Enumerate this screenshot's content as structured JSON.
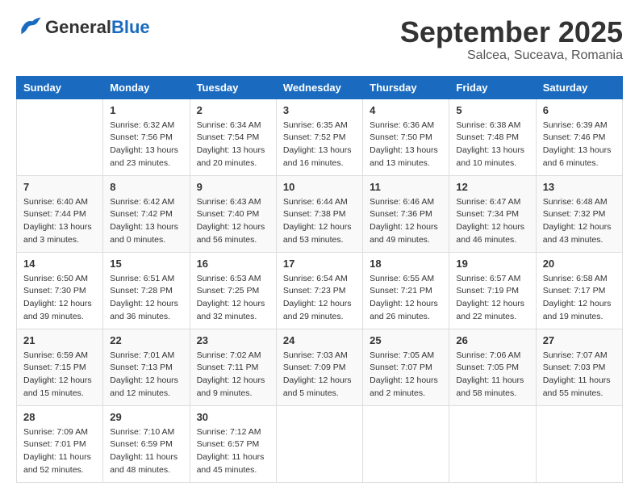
{
  "header": {
    "logo_general": "General",
    "logo_blue": "Blue",
    "month": "September 2025",
    "location": "Salcea, Suceava, Romania"
  },
  "weekdays": [
    "Sunday",
    "Monday",
    "Tuesday",
    "Wednesday",
    "Thursday",
    "Friday",
    "Saturday"
  ],
  "weeks": [
    [
      {
        "day": "",
        "sunrise": "",
        "sunset": "",
        "daylight": ""
      },
      {
        "day": "1",
        "sunrise": "Sunrise: 6:32 AM",
        "sunset": "Sunset: 7:56 PM",
        "daylight": "Daylight: 13 hours and 23 minutes."
      },
      {
        "day": "2",
        "sunrise": "Sunrise: 6:34 AM",
        "sunset": "Sunset: 7:54 PM",
        "daylight": "Daylight: 13 hours and 20 minutes."
      },
      {
        "day": "3",
        "sunrise": "Sunrise: 6:35 AM",
        "sunset": "Sunset: 7:52 PM",
        "daylight": "Daylight: 13 hours and 16 minutes."
      },
      {
        "day": "4",
        "sunrise": "Sunrise: 6:36 AM",
        "sunset": "Sunset: 7:50 PM",
        "daylight": "Daylight: 13 hours and 13 minutes."
      },
      {
        "day": "5",
        "sunrise": "Sunrise: 6:38 AM",
        "sunset": "Sunset: 7:48 PM",
        "daylight": "Daylight: 13 hours and 10 minutes."
      },
      {
        "day": "6",
        "sunrise": "Sunrise: 6:39 AM",
        "sunset": "Sunset: 7:46 PM",
        "daylight": "Daylight: 13 hours and 6 minutes."
      }
    ],
    [
      {
        "day": "7",
        "sunrise": "Sunrise: 6:40 AM",
        "sunset": "Sunset: 7:44 PM",
        "daylight": "Daylight: 13 hours and 3 minutes."
      },
      {
        "day": "8",
        "sunrise": "Sunrise: 6:42 AM",
        "sunset": "Sunset: 7:42 PM",
        "daylight": "Daylight: 13 hours and 0 minutes."
      },
      {
        "day": "9",
        "sunrise": "Sunrise: 6:43 AM",
        "sunset": "Sunset: 7:40 PM",
        "daylight": "Daylight: 12 hours and 56 minutes."
      },
      {
        "day": "10",
        "sunrise": "Sunrise: 6:44 AM",
        "sunset": "Sunset: 7:38 PM",
        "daylight": "Daylight: 12 hours and 53 minutes."
      },
      {
        "day": "11",
        "sunrise": "Sunrise: 6:46 AM",
        "sunset": "Sunset: 7:36 PM",
        "daylight": "Daylight: 12 hours and 49 minutes."
      },
      {
        "day": "12",
        "sunrise": "Sunrise: 6:47 AM",
        "sunset": "Sunset: 7:34 PM",
        "daylight": "Daylight: 12 hours and 46 minutes."
      },
      {
        "day": "13",
        "sunrise": "Sunrise: 6:48 AM",
        "sunset": "Sunset: 7:32 PM",
        "daylight": "Daylight: 12 hours and 43 minutes."
      }
    ],
    [
      {
        "day": "14",
        "sunrise": "Sunrise: 6:50 AM",
        "sunset": "Sunset: 7:30 PM",
        "daylight": "Daylight: 12 hours and 39 minutes."
      },
      {
        "day": "15",
        "sunrise": "Sunrise: 6:51 AM",
        "sunset": "Sunset: 7:28 PM",
        "daylight": "Daylight: 12 hours and 36 minutes."
      },
      {
        "day": "16",
        "sunrise": "Sunrise: 6:53 AM",
        "sunset": "Sunset: 7:25 PM",
        "daylight": "Daylight: 12 hours and 32 minutes."
      },
      {
        "day": "17",
        "sunrise": "Sunrise: 6:54 AM",
        "sunset": "Sunset: 7:23 PM",
        "daylight": "Daylight: 12 hours and 29 minutes."
      },
      {
        "day": "18",
        "sunrise": "Sunrise: 6:55 AM",
        "sunset": "Sunset: 7:21 PM",
        "daylight": "Daylight: 12 hours and 26 minutes."
      },
      {
        "day": "19",
        "sunrise": "Sunrise: 6:57 AM",
        "sunset": "Sunset: 7:19 PM",
        "daylight": "Daylight: 12 hours and 22 minutes."
      },
      {
        "day": "20",
        "sunrise": "Sunrise: 6:58 AM",
        "sunset": "Sunset: 7:17 PM",
        "daylight": "Daylight: 12 hours and 19 minutes."
      }
    ],
    [
      {
        "day": "21",
        "sunrise": "Sunrise: 6:59 AM",
        "sunset": "Sunset: 7:15 PM",
        "daylight": "Daylight: 12 hours and 15 minutes."
      },
      {
        "day": "22",
        "sunrise": "Sunrise: 7:01 AM",
        "sunset": "Sunset: 7:13 PM",
        "daylight": "Daylight: 12 hours and 12 minutes."
      },
      {
        "day": "23",
        "sunrise": "Sunrise: 7:02 AM",
        "sunset": "Sunset: 7:11 PM",
        "daylight": "Daylight: 12 hours and 9 minutes."
      },
      {
        "day": "24",
        "sunrise": "Sunrise: 7:03 AM",
        "sunset": "Sunset: 7:09 PM",
        "daylight": "Daylight: 12 hours and 5 minutes."
      },
      {
        "day": "25",
        "sunrise": "Sunrise: 7:05 AM",
        "sunset": "Sunset: 7:07 PM",
        "daylight": "Daylight: 12 hours and 2 minutes."
      },
      {
        "day": "26",
        "sunrise": "Sunrise: 7:06 AM",
        "sunset": "Sunset: 7:05 PM",
        "daylight": "Daylight: 11 hours and 58 minutes."
      },
      {
        "day": "27",
        "sunrise": "Sunrise: 7:07 AM",
        "sunset": "Sunset: 7:03 PM",
        "daylight": "Daylight: 11 hours and 55 minutes."
      }
    ],
    [
      {
        "day": "28",
        "sunrise": "Sunrise: 7:09 AM",
        "sunset": "Sunset: 7:01 PM",
        "daylight": "Daylight: 11 hours and 52 minutes."
      },
      {
        "day": "29",
        "sunrise": "Sunrise: 7:10 AM",
        "sunset": "Sunset: 6:59 PM",
        "daylight": "Daylight: 11 hours and 48 minutes."
      },
      {
        "day": "30",
        "sunrise": "Sunrise: 7:12 AM",
        "sunset": "Sunset: 6:57 PM",
        "daylight": "Daylight: 11 hours and 45 minutes."
      },
      {
        "day": "",
        "sunrise": "",
        "sunset": "",
        "daylight": ""
      },
      {
        "day": "",
        "sunrise": "",
        "sunset": "",
        "daylight": ""
      },
      {
        "day": "",
        "sunrise": "",
        "sunset": "",
        "daylight": ""
      },
      {
        "day": "",
        "sunrise": "",
        "sunset": "",
        "daylight": ""
      }
    ]
  ]
}
